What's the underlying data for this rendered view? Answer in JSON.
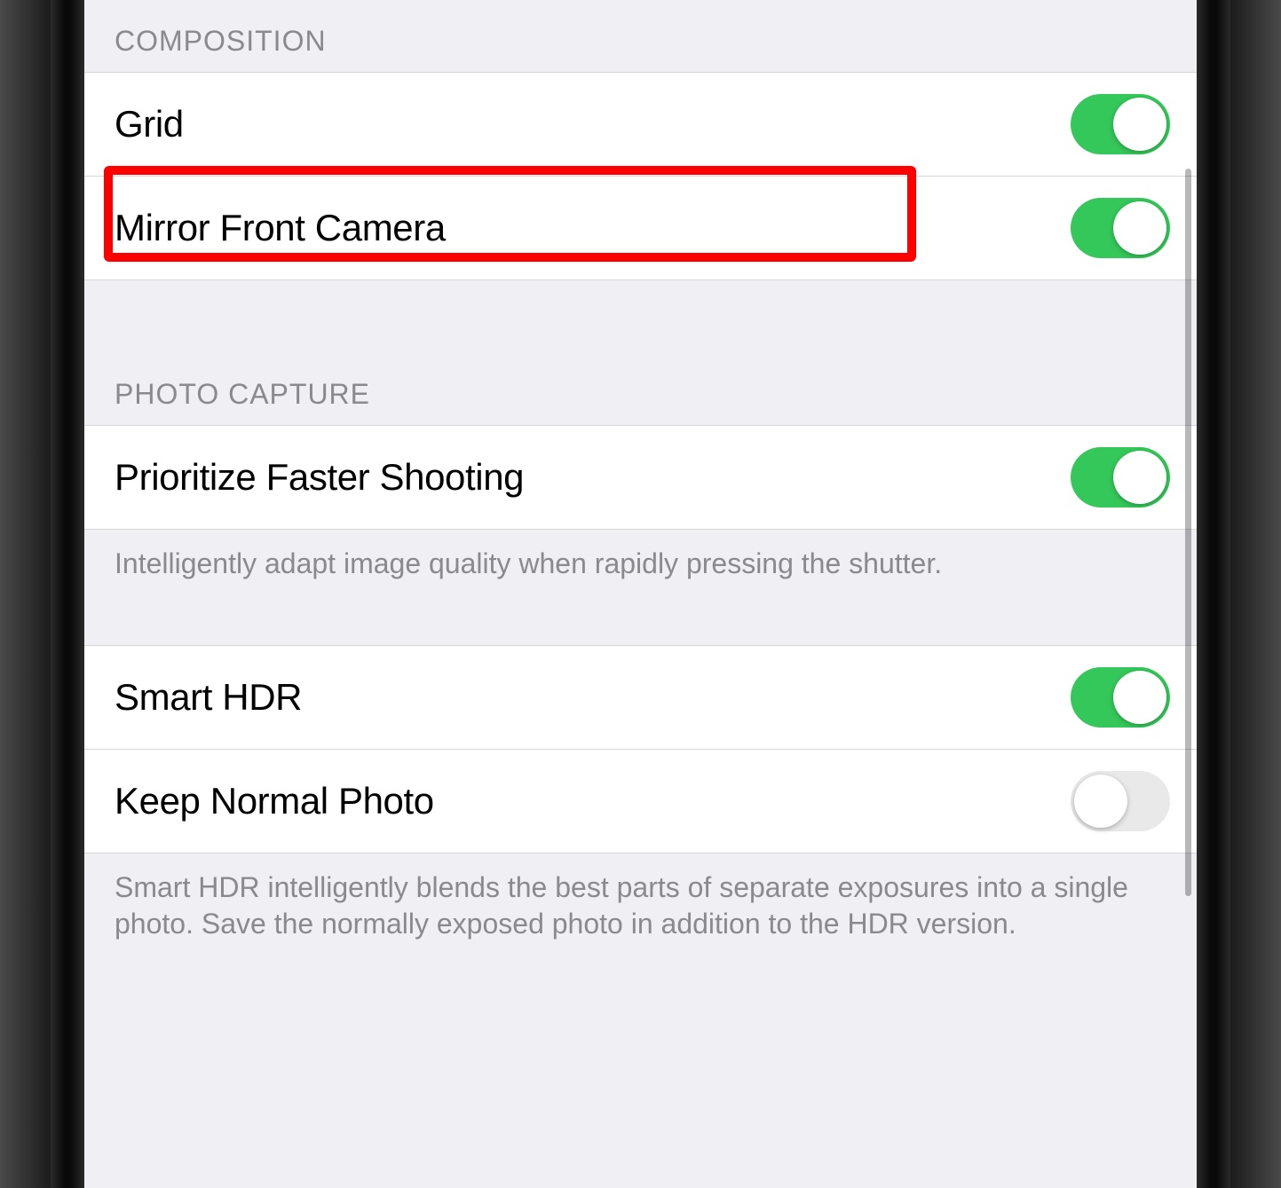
{
  "sections": {
    "composition": {
      "header": "COMPOSITION",
      "grid": {
        "label": "Grid",
        "on": true
      },
      "mirror_front_camera": {
        "label": "Mirror Front Camera",
        "on": true
      }
    },
    "photo_capture": {
      "header": "PHOTO CAPTURE",
      "prioritize_faster_shooting": {
        "label": "Prioritize Faster Shooting",
        "on": true
      },
      "prioritize_footer": "Intelligently adapt image quality when rapidly pressing the shutter.",
      "smart_hdr": {
        "label": "Smart HDR",
        "on": true
      },
      "keep_normal_photo": {
        "label": "Keep Normal Photo",
        "on": false
      },
      "hdr_footer": "Smart HDR intelligently blends the best parts of separate exposures into a single photo. Save the normally exposed photo in addition to the HDR version."
    }
  },
  "highlight": {
    "target": "mirror_front_camera"
  },
  "colors": {
    "toggle_on": "#34c759",
    "toggle_off": "#e9e9ea",
    "highlight": "#ff0000"
  }
}
